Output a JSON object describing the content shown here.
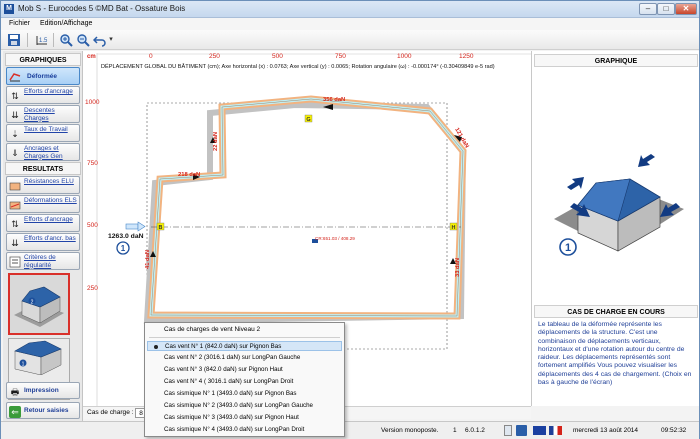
{
  "window": {
    "title": "Mob S - Eurocodes 5 ©MD Bat - Ossature  Bois",
    "app_icon": "M"
  },
  "menu": [
    "Fichier",
    "Edition/Affichage"
  ],
  "left": {
    "graphiques_title": "GRAPHIQUES",
    "resultats_title": "RESULTATS",
    "graph_buttons": [
      {
        "label": "Déformée",
        "icon": "deformee-icon",
        "active": true
      },
      {
        "label": "Efforts d'ancrage",
        "icon": "anchor-forces-icon"
      },
      {
        "label": "Descentes Charges",
        "icon": "load-descent-icon"
      },
      {
        "label": "Taux de Travail",
        "icon": "work-rate-icon"
      },
      {
        "label": "Ancrages et Charges Gen",
        "icon": "anchors-loads-icon"
      }
    ],
    "result_buttons": [
      {
        "label": "Résistances ELU",
        "icon": "resistance-elu-icon"
      },
      {
        "label": "Déformations ELS",
        "icon": "deformation-els-icon"
      },
      {
        "label": "Efforts d'ancrage",
        "icon": "anchor-forces-icon"
      },
      {
        "label": "Efforts d'ancr. bas",
        "icon": "anchor-bottom-icon"
      },
      {
        "label": "Critères de régularité",
        "icon": "regularity-icon"
      }
    ],
    "thumb_badges": [
      "2",
      "1"
    ],
    "impression": "Impression",
    "retour": "Retour saisies"
  },
  "drawing": {
    "header": "DÉPLACEMENT GLOBAL DU BÂTIMENT  (cm);   Axe horizontal (x) : 0.0763;   Axe vertical (y) : 0.0065;   Rotation angulaire (ω) : -0.000174°   (-0.30409849 e-5 rad)",
    "unit": "cm",
    "ruler_x": [
      "0",
      "250",
      "500",
      "750",
      "1000",
      "1250"
    ],
    "ruler_y": [
      "1000",
      "750",
      "500",
      "250"
    ],
    "forces": [
      {
        "label": "356 daN"
      },
      {
        "label": "22 daN"
      },
      {
        "label": "218 daN"
      },
      {
        "label": "121 daN"
      },
      {
        "label": "33 daN"
      },
      {
        "label": "41 daN"
      }
    ],
    "load": "1263.0 daN",
    "wind_badge": "1",
    "axis_labels": [
      "G",
      "B",
      "H"
    ],
    "cr_label": "CR:651.03 / 408.29"
  },
  "context_menu": {
    "header": "Cas de charges de vent Niveau 2",
    "items": [
      {
        "label": "Cas vent N° 1 (842.0 daN) sur Pignon Bas",
        "checked": true
      },
      {
        "label": "Cas vent N° 2 (3016.1 daN) sur LongPan Gauche",
        "checked": false
      },
      {
        "label": "Cas vent N° 3 (842.0 daN) sur Pignon Haut",
        "checked": false
      },
      {
        "label": "Cas vent N° 4 ( 3016.1 daN) sur LongPan Droit",
        "checked": false
      },
      {
        "label": "Cas sismique N° 1 (3493.0 daN) sur Pignon Bas",
        "checked": false
      },
      {
        "label": "Cas sismique N° 2 (3493.0 daN) sur LongPan Gauche",
        "checked": false
      },
      {
        "label": "Cas sismique N° 3 (3493.0 daN) sur Pignon Haut",
        "checked": false
      },
      {
        "label": "Cas sismique N° 4 (3493.0 daN) sur LongPan Droit",
        "checked": false
      }
    ]
  },
  "bottom": {
    "cas_label": "Cas de charge :",
    "cas_value": "8"
  },
  "right": {
    "graphique_title": "GRAPHIQUE",
    "cas_title": "CAS DE CHARGE EN COURS",
    "wind_badge": "1",
    "description": "Le tableau de la déformée représente les déplacements de la structure. C'est une combinaison de déplacements verticaux, horizontaux et d'une rotation autour du centre de raideur. Les déplacements représentés sont fortement amplifiés Vous pouvez visualiser les déplacements des 4 cas de chargement. (Choix en bas à gauche de l'écran)"
  },
  "status": {
    "version": "Version monoposte.",
    "num": "1",
    "build": "6.0.1.2",
    "date": "mercredi  13  août  2014",
    "time": "09:52:32"
  },
  "colors": {
    "accent": "#1d4f9b",
    "force_label": "#d4231a",
    "wall_orange": "#f2b380",
    "wall_cyan": "#bfeef3",
    "text_blue": "#1f3f97"
  }
}
